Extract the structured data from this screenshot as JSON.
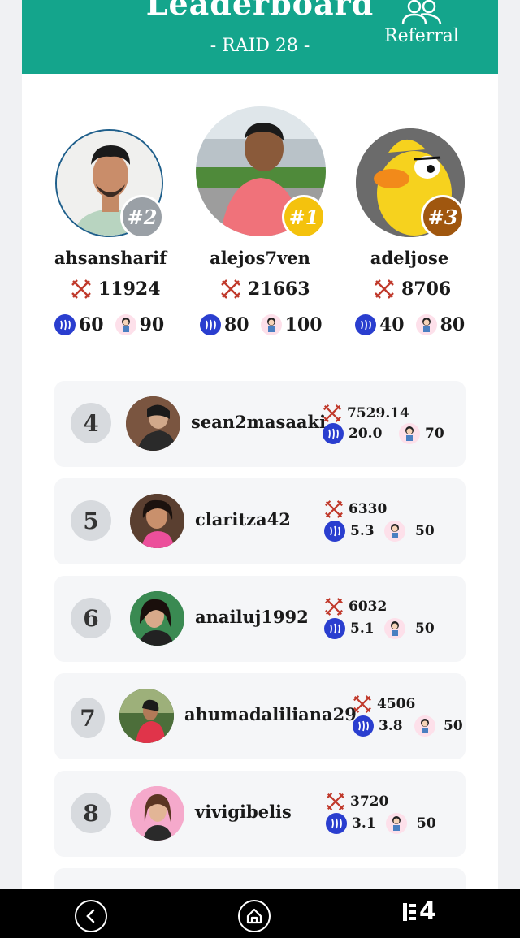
{
  "header": {
    "title": "Leaderboard",
    "subtitle": "- RAID 28 -",
    "referral_label": "Referral",
    "referral_icon": "people-icon"
  },
  "podium": [
    {
      "rank": "#2",
      "name": "ahsansharif",
      "score": "11924",
      "steem": "60",
      "other": "90",
      "badge_color": "#9aa0a6"
    },
    {
      "rank": "#1",
      "name": "alejos7ven",
      "score": "21663",
      "steem": "80",
      "other": "100",
      "badge_color": "#f4c20d"
    },
    {
      "rank": "#3",
      "name": "adeljose",
      "score": "8706",
      "steem": "40",
      "other": "80",
      "badge_color": "#a0570f"
    }
  ],
  "rows": [
    {
      "rank": "4",
      "name": "sean2masaaki",
      "score": "7529.14",
      "steem": "20.0",
      "other": "70"
    },
    {
      "rank": "5",
      "name": "claritza42",
      "score": "6330",
      "steem": "5.3",
      "other": "50"
    },
    {
      "rank": "6",
      "name": "anailuj1992",
      "score": "6032",
      "steem": "5.1",
      "other": "50"
    },
    {
      "rank": "7",
      "name": "ahumadaliliana29",
      "score": "4506",
      "steem": "3.8",
      "other": "50"
    },
    {
      "rank": "8",
      "name": "vivigibelis",
      "score": "3720",
      "steem": "3.1",
      "other": "50"
    }
  ],
  "nav": {
    "back_icon": "back-icon",
    "home_icon": "home-icon",
    "tab_count": "4"
  },
  "colors": {
    "accent": "#14a58c",
    "steem": "#2a3ecf",
    "sword": "#c0392b"
  }
}
